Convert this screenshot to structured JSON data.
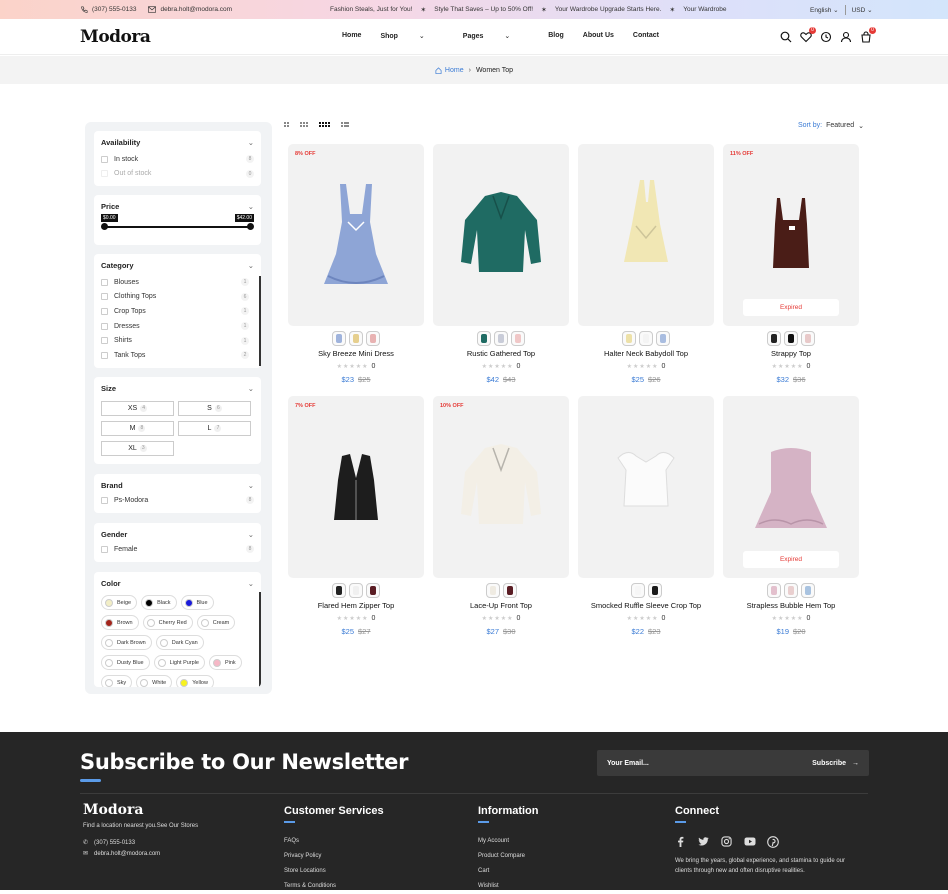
{
  "topbar": {
    "phone": "(307) 555-0133",
    "email": "debra.holt@modora.com",
    "ticker": [
      "Fashion Steals, Just for You!",
      "Style That Saves – Up to 50% Off!",
      "Your Wardrobe Upgrade Starts Here.",
      "Your Wardrobe"
    ],
    "language": "English",
    "currency": "USD"
  },
  "header": {
    "logo": "Modora",
    "nav": [
      "Home",
      "Shop",
      "Pages",
      "Blog",
      "About Us",
      "Contact"
    ],
    "wishlist_count": "0",
    "cart_count": "0"
  },
  "breadcrumb": {
    "home": "Home",
    "current": "Women Top"
  },
  "filters": {
    "availability": {
      "title": "Availability",
      "items": [
        {
          "label": "In stock",
          "count": "8"
        },
        {
          "label": "Out of stock",
          "count": "0"
        }
      ]
    },
    "price": {
      "title": "Price",
      "min": "$0.00",
      "max": "$42.00"
    },
    "category": {
      "title": "Category",
      "items": [
        {
          "label": "Blouses",
          "count": "1"
        },
        {
          "label": "Clothing Tops",
          "count": "6"
        },
        {
          "label": "Crop Tops",
          "count": "1"
        },
        {
          "label": "Dresses",
          "count": "1"
        },
        {
          "label": "Shirts",
          "count": "1"
        },
        {
          "label": "Tank Tops",
          "count": "2"
        }
      ]
    },
    "size": {
      "title": "Size",
      "items": [
        {
          "label": "XS",
          "count": "4"
        },
        {
          "label": "S",
          "count": "6"
        },
        {
          "label": "M",
          "count": "8"
        },
        {
          "label": "L",
          "count": "7"
        },
        {
          "label": "XL",
          "count": "3"
        }
      ]
    },
    "brand": {
      "title": "Brand",
      "items": [
        {
          "label": "Ps-Modora",
          "count": "8"
        }
      ]
    },
    "gender": {
      "title": "Gender",
      "items": [
        {
          "label": "Female",
          "count": "8"
        }
      ]
    },
    "color": {
      "title": "Color",
      "items": [
        {
          "label": "Beige",
          "hex": "#f2eec6"
        },
        {
          "label": "Black",
          "hex": "#000000"
        },
        {
          "label": "Blue",
          "hex": "#1a1adb"
        },
        {
          "label": "Brown",
          "hex": "#a3241b"
        },
        {
          "label": "Cherry Red",
          "hex": "#ffffff"
        },
        {
          "label": "Cream",
          "hex": "#ffffff"
        },
        {
          "label": "Dark Brown",
          "hex": "#ffffff"
        },
        {
          "label": "Dark Cyan",
          "hex": "#ffffff"
        },
        {
          "label": "Dusty Blue",
          "hex": "#ffffff"
        },
        {
          "label": "Light Purple",
          "hex": "#ffffff"
        },
        {
          "label": "Pink",
          "hex": "#f6b7c6"
        },
        {
          "label": "Sky",
          "hex": "#ffffff"
        },
        {
          "label": "White",
          "hex": "#ffffff"
        },
        {
          "label": "Yellow",
          "hex": "#f7f21e"
        }
      ]
    }
  },
  "toolbar": {
    "sort_label": "Sort by:",
    "sort_value": "Featured"
  },
  "products": [
    {
      "name": "Sky Breeze Mini Dress",
      "price": "$23",
      "old": "$25",
      "discount": "8% OFF",
      "expired": "",
      "reviews": "0",
      "garment": "dress",
      "color": "#8ea5d6",
      "thumbs": [
        "#9fb3dc",
        "#e6cf8e",
        "#e8b2b2"
      ]
    },
    {
      "name": "Rustic Gathered Top",
      "price": "$42",
      "old": "$43",
      "discount": "",
      "expired": "",
      "reviews": "0",
      "garment": "blouse",
      "color": "#1f6b63",
      "thumbs": [
        "#1f6b63",
        "#c9ccd8",
        "#f0c7c7"
      ]
    },
    {
      "name": "Halter Neck Babydoll Top",
      "price": "$25",
      "old": "$26",
      "discount": "",
      "expired": "",
      "reviews": "0",
      "garment": "halter",
      "color": "#f1e7b4",
      "thumbs": [
        "#ede1a8",
        "#f4f4f4",
        "#a9bde0"
      ]
    },
    {
      "name": "Strappy Top",
      "price": "$32",
      "old": "$36",
      "discount": "11% OFF",
      "expired": "Expired",
      "reviews": "0",
      "garment": "tank",
      "color": "#4a1d17",
      "thumbs": [
        "#222222",
        "#111111",
        "#e8c9c9"
      ]
    },
    {
      "name": "Flared Hem Zipper Top",
      "price": "$25",
      "old": "$27",
      "discount": "7% OFF",
      "expired": "",
      "reviews": "0",
      "garment": "vest",
      "color": "#1d1d1d",
      "thumbs": [
        "#222222",
        "#f0f0f0",
        "#5a1d24"
      ]
    },
    {
      "name": "Lace-Up Front Top",
      "price": "$27",
      "old": "$30",
      "discount": "10% OFF",
      "expired": "",
      "reviews": "0",
      "garment": "blouse",
      "color": "#f3efe6",
      "thumbs": [
        "#efebe2",
        "#5a1d24"
      ]
    },
    {
      "name": "Smocked Ruffle Sleeve Crop Top",
      "price": "$22",
      "old": "$23",
      "discount": "",
      "expired": "",
      "reviews": "0",
      "garment": "crop",
      "color": "#fbfbfb",
      "thumbs": [
        "#f6f6f6",
        "#1a1a1a"
      ]
    },
    {
      "name": "Strapless Bubble Hem Top",
      "price": "$19",
      "old": "$20",
      "discount": "",
      "expired": "Expired",
      "reviews": "0",
      "garment": "strapless",
      "color": "#d5b3c5",
      "thumbs": [
        "#e3c0cd",
        "#e9cfcf",
        "#a9c3e0"
      ]
    }
  ],
  "footer": {
    "newsletter_title": "Subscribe to Our Newsletter",
    "email_placeholder": "Your Email...",
    "subscribe": "Subscribe",
    "logo": "Modora",
    "tagline": "Find a location nearest you.See Our Stores",
    "phone": "(307) 555-0133",
    "email": "debra.holt@modora.com",
    "customer_services": {
      "title": "Customer Services",
      "links": [
        "FAQs",
        "Privacy Policy",
        "Store Locations",
        "Terms & Conditions"
      ]
    },
    "information": {
      "title": "Information",
      "links": [
        "My Account",
        "Product Compare",
        "Cart",
        "Wishlist"
      ]
    },
    "connect": {
      "title": "Connect",
      "text": "We bring the years, global experience, and stamina to guide our clients through new and often disruptive realities."
    }
  }
}
